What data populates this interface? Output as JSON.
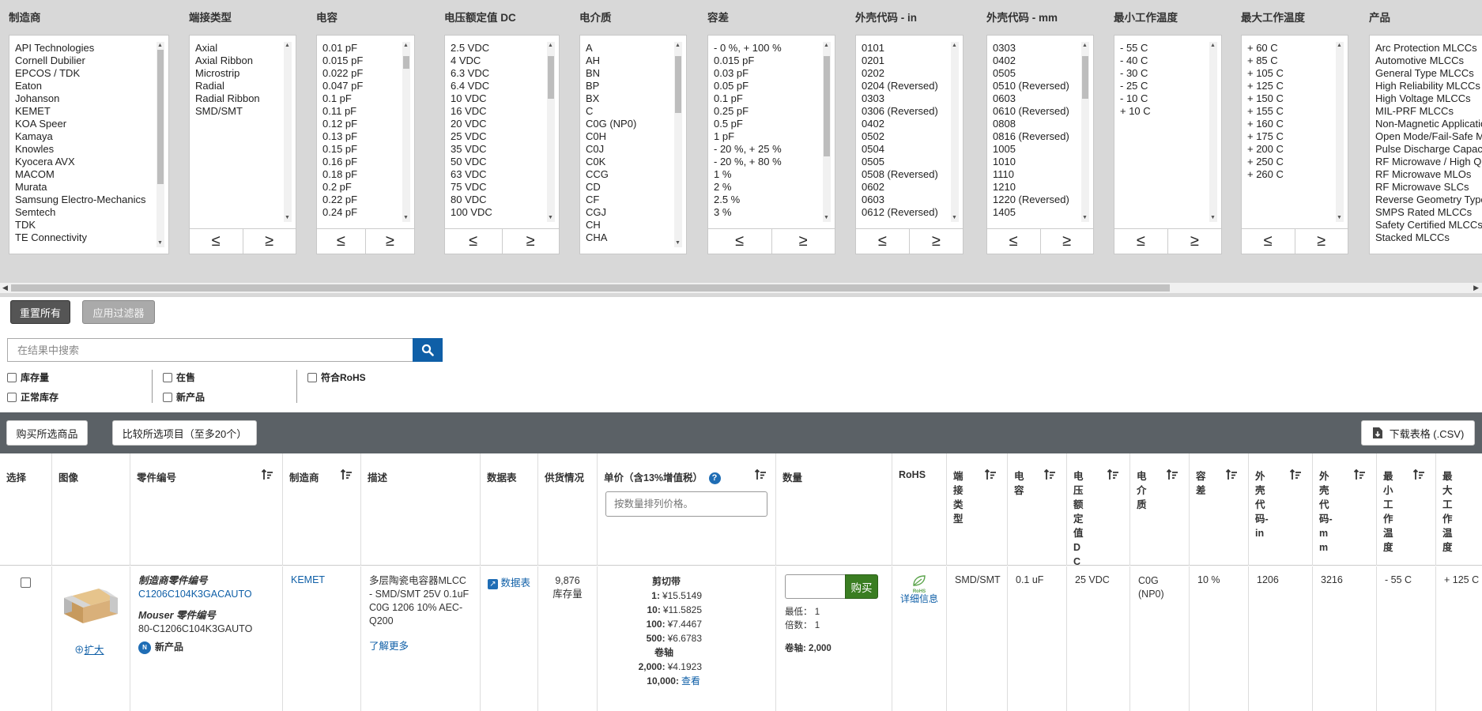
{
  "filters": [
    {
      "title": "制造商",
      "items": [
        "API Technologies",
        "Cornell Dubilier",
        "EPCOS / TDK",
        "Eaton",
        "Johanson",
        "KEMET",
        "KOA Speer",
        "Kamaya",
        "Knowles",
        "Kyocera AVX",
        "MACOM",
        "Murata",
        "Samsung Electro-Mechanics",
        "Semtech",
        "TDK",
        "TE Connectivity"
      ]
    },
    {
      "title": "端接类型",
      "items": [
        "Axial",
        "Axial Ribbon",
        "Microstrip",
        "Radial",
        "Radial Ribbon",
        "SMD/SMT"
      ]
    },
    {
      "title": "电容",
      "items": [
        "0.01 pF",
        "0.015 pF",
        "0.022 pF",
        "0.047 pF",
        "0.1 pF",
        "0.11 pF",
        "0.12 pF",
        "0.13 pF",
        "0.15 pF",
        "0.16 pF",
        "0.18 pF",
        "0.2 pF",
        "0.22 pF",
        "0.24 pF"
      ]
    },
    {
      "title": "电压额定值 DC",
      "items": [
        "2.5 VDC",
        "4 VDC",
        "6.3 VDC",
        "6.4 VDC",
        "10 VDC",
        "16 VDC",
        "20 VDC",
        "25 VDC",
        "35 VDC",
        "50 VDC",
        "63 VDC",
        "75 VDC",
        "80 VDC",
        "100 VDC"
      ]
    },
    {
      "title": "电介质",
      "items": [
        "A",
        "AH",
        "BN",
        "BP",
        "BX",
        "C",
        "C0G (NP0)",
        "C0H",
        "C0J",
        "C0K",
        "CCG",
        "CD",
        "CF",
        "CGJ",
        "CH",
        "CHA"
      ]
    },
    {
      "title": "容差",
      "items": [
        "- 0 %, + 100 %",
        "0.015 pF",
        "0.03 pF",
        "0.05 pF",
        "0.1 pF",
        "0.25 pF",
        "0.5 pF",
        "1 pF",
        "- 20 %, + 25 %",
        "- 20 %, + 80 %",
        "1 %",
        "2 %",
        "2.5 %",
        "3 %"
      ]
    },
    {
      "title": "外壳代码 - in",
      "items": [
        "0101",
        "0201",
        "0202",
        "0204 (Reversed)",
        "0303",
        "0306 (Reversed)",
        "0402",
        "0502",
        "0504",
        "0505",
        "0508 (Reversed)",
        "0602",
        "0603",
        "0612 (Reversed)"
      ]
    },
    {
      "title": "外壳代码 - mm",
      "items": [
        "0303",
        "0402",
        "0505",
        "0510 (Reversed)",
        "0603",
        "0610 (Reversed)",
        "0808",
        "0816 (Reversed)",
        "1005",
        "1010",
        "1110",
        "1210",
        "1220 (Reversed)",
        "1405"
      ]
    },
    {
      "title": "最小工作温度",
      "items": [
        "- 55 C",
        "- 40 C",
        "- 30 C",
        "- 25 C",
        "- 10 C",
        "+ 10 C"
      ]
    },
    {
      "title": "最大工作温度",
      "items": [
        "+ 60 C",
        "+ 85 C",
        "+ 105 C",
        "+ 125 C",
        "+ 150 C",
        "+ 155 C",
        "+ 160 C",
        "+ 175 C",
        "+ 200 C",
        "+ 250 C",
        "+ 260 C"
      ]
    },
    {
      "title": "产品",
      "items": [
        "Arc Protection MLCCs",
        "Automotive MLCCs",
        "General Type MLCCs",
        "High Reliability MLCCs",
        "High Voltage MLCCs",
        "MIL-PRF MLCCs",
        "Non-Magnetic Applications",
        "Open Mode/Fail-Safe MLCCs",
        "Pulse Discharge Capacitors",
        "RF Microwave / High Q",
        "RF Microwave MLOs",
        "RF Microwave SLCs",
        "Reverse Geometry Type",
        "SMPS Rated MLCCs",
        "Safety Certified MLCCs",
        "Stacked MLCCs"
      ]
    }
  ],
  "compare": {
    "lte": "≤",
    "gte": "≥"
  },
  "buttons": {
    "reset_all": "重置所有",
    "apply_filters": "应用过滤器"
  },
  "search": {
    "placeholder": "在结果中搜索"
  },
  "checkboxes": {
    "in_stock": "库存量",
    "normal_stock": "正常库存",
    "on_sale": "在售",
    "new_product": "新产品",
    "rohs": "符合RoHS"
  },
  "actions": {
    "buy_selected": "购买所选商品",
    "compare_selected": "比较所选项目（至多20个）",
    "download": "下载表格 (.CSV)"
  },
  "columns": {
    "select": "选择",
    "image": "图像",
    "part_no": "零件编号",
    "manufacturer": "制造商",
    "description": "描述",
    "datasheet": "数据表",
    "availability": "供货情况",
    "unit_price": "单价（含13%增值税）",
    "qty": "数量",
    "rohs": "RoHS",
    "term_type": "端接类型",
    "capacitance": "电容",
    "voltage_dc": "电压额定值DC",
    "dielectric": "电介质",
    "tolerance": "容差",
    "case_in": "外壳代码 - in",
    "case_mm": "外壳代码 - mm",
    "min_temp": "最小工作温度",
    "max_temp": "最大工作温度"
  },
  "price_placeholder": "按数量排列价格。",
  "row": {
    "mfr_pn_label": "制造商零件编号",
    "mfr_pn": "C1206C104K3GACAUTO",
    "mouser_pn_label": "Mouser 零件编号",
    "mouser_pn": "80-C1206C104K3GAUTO",
    "new_badge": "新产品",
    "enlarge": "扩大",
    "manufacturer": "KEMET",
    "description": "多层陶瓷电容器MLCC - SMD/SMT 25V 0.1uF C0G 1206 10% AEC-Q200",
    "learn_more": "了解更多",
    "datasheet": "数据表",
    "stock_qty": "9,876",
    "stock_label": "库存量",
    "cut_tape_label": "剪切带",
    "cut_tape": [
      {
        "q": "1:",
        "p": "¥15.5149"
      },
      {
        "q": "10:",
        "p": "¥11.5825"
      },
      {
        "q": "100:",
        "p": "¥7.4467"
      },
      {
        "q": "500:",
        "p": "¥6.6783"
      }
    ],
    "reel_label": "卷轴",
    "reel": [
      {
        "q": "2,000:",
        "p": "¥4.1923"
      }
    ],
    "reel_more_q": "10,000:",
    "reel_more_link": "查看",
    "buy": "购买",
    "min_label": "最低：",
    "min_val": "1",
    "mult_label": "倍数：",
    "mult_val": "1",
    "reel_qty_label": "卷轴:",
    "reel_qty": "2,000",
    "rohs_detail": "详细信息",
    "rohs_icon_text": "RoHS",
    "term_type": "SMD/SMT",
    "capacitance": "0.1 uF",
    "voltage": "25 VDC",
    "dielectric": "C0G (NP0)",
    "tolerance": "10 %",
    "case_in": "1206",
    "case_mm": "3216",
    "min_temp": "- 55 C",
    "max_temp": "+ 125 C"
  }
}
